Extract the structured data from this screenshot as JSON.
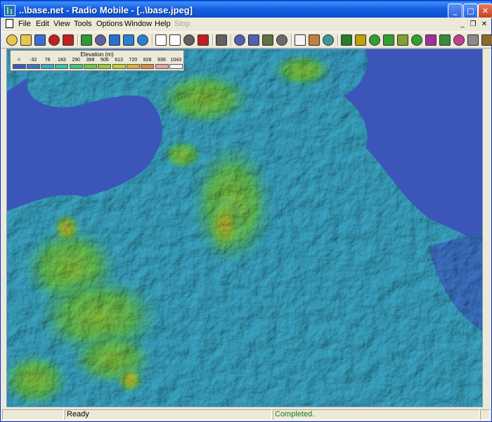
{
  "window": {
    "title": "..\\base.net - Radio Mobile - [..\\base.jpeg]"
  },
  "menu": [
    "File",
    "Edit",
    "View",
    "Tools",
    "Options",
    "Window",
    "Help",
    "Stop"
  ],
  "legend": {
    "title": "Elevation (m)",
    "labels": [
      "<",
      "-32",
      "76",
      "183",
      "290",
      "398",
      "506",
      "613",
      "720",
      "828",
      "936",
      "1043"
    ],
    "colors": [
      "#3b5ab8",
      "#3d74c4",
      "#3aa7c6",
      "#3cbfa8",
      "#45c27e",
      "#6dc44e",
      "#98c83c",
      "#c5cc38",
      "#d8b03c",
      "#d88a48",
      "#e2a6a6",
      "#f2f2f2"
    ]
  },
  "status": {
    "ready": "Ready",
    "completed": "Completed."
  },
  "icons": [
    "new-icon",
    "open-icon",
    "save-icon",
    "cut-icon",
    "pick-icon",
    "globe-icon",
    "map-icon",
    "target-icon",
    "back-icon",
    "forward-icon",
    "window-icon",
    "export-icon",
    "disk-icon",
    "pdf-icon",
    "print-icon",
    "copy-icon",
    "paste-icon",
    "network-icon",
    "properties-icon",
    "frame-icon",
    "person-icon",
    "zoom-icon",
    "antenna-icon",
    "radio-link-icon",
    "coverage-icon",
    "polar-icon",
    "route-icon",
    "scan-icon",
    "hills-icon",
    "profile-icon",
    "wave-icon",
    "settings-icon",
    "exit-icon"
  ]
}
